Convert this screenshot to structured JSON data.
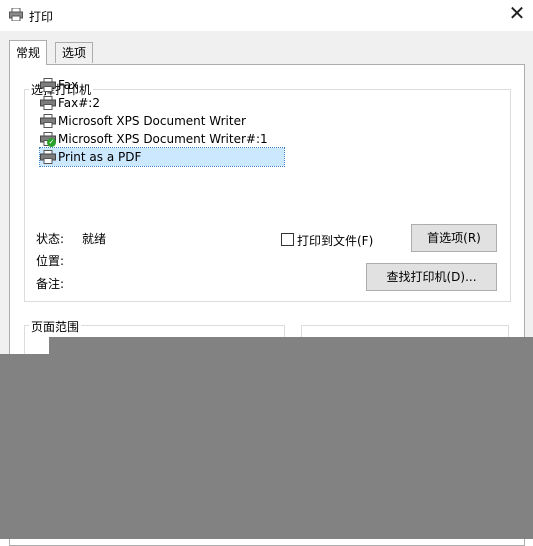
{
  "window": {
    "title": "打印",
    "close_glyph": "✕"
  },
  "tabs": [
    {
      "label": "常规"
    },
    {
      "label": "选项"
    }
  ],
  "printer_group": {
    "title": "选择打印机",
    "printers": [
      {
        "name": "Fax",
        "icon": "printer-icon"
      },
      {
        "name": "Fax#:2",
        "icon": "printer-icon"
      },
      {
        "name": "Microsoft XPS Document Writer",
        "icon": "printer-icon"
      },
      {
        "name": "Microsoft XPS Document Writer#:1",
        "icon": "default-printer-icon"
      },
      {
        "name": "Print as a PDF",
        "icon": "printer-icon",
        "selected": true
      }
    ],
    "status_label": "状态:",
    "status_value": "就绪",
    "location_label": "位置:",
    "comment_label": "备注:",
    "print_to_file_label": "打印到文件(F)",
    "preferences_button": "首选项(R)",
    "find_printer_button": "查找打印机(D)..."
  },
  "page_range_group": {
    "title": "页面范围"
  },
  "colors": {
    "selection": "#cce8ff",
    "overlay": "#828282",
    "dialog_bg": "#f0f0f0"
  }
}
